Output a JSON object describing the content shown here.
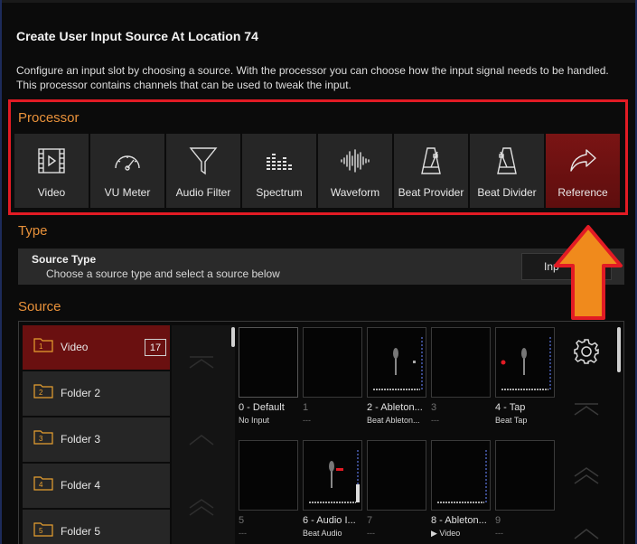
{
  "dialog": {
    "title": "Create User Input Source At Location 74",
    "description": "Configure an input slot by choosing a source. With the processor you can choose how the input signal needs to be handled. This processor contains channels that can be used to tweak the input."
  },
  "processor": {
    "label": "Processor",
    "buttons": [
      {
        "label": "Video",
        "icon": "video-icon"
      },
      {
        "label": "VU Meter",
        "icon": "gauge-icon"
      },
      {
        "label": "Audio Filter",
        "icon": "funnel-icon"
      },
      {
        "label": "Spectrum",
        "icon": "spectrum-icon"
      },
      {
        "label": "Waveform",
        "icon": "waveform-icon"
      },
      {
        "label": "Beat Provider",
        "icon": "metronome-icon"
      },
      {
        "label": "Beat Divider",
        "icon": "metronome-icon"
      },
      {
        "label": "Reference",
        "icon": "share-arrow-icon",
        "selected": true
      }
    ],
    "highlight_color": "#e21b24"
  },
  "type": {
    "label": "Type",
    "source_type_heading": "Source Type",
    "source_type_hint": "Choose a source type and select a source below",
    "button_label": "Inp"
  },
  "source": {
    "label": "Source",
    "folders": [
      {
        "num": "1",
        "name": "Video",
        "count": "17",
        "selected": true
      },
      {
        "num": "2",
        "name": "Folder 2"
      },
      {
        "num": "3",
        "name": "Folder 3"
      },
      {
        "num": "4",
        "name": "Folder 4"
      },
      {
        "num": "5",
        "name": "Folder 5"
      }
    ],
    "tiles": [
      {
        "title": "0 - Default",
        "subtitle": "No Input"
      },
      {
        "title": "1",
        "subtitle": "---"
      },
      {
        "title": "2 - Ableton...",
        "subtitle": "Beat  Ableton..."
      },
      {
        "title": "3",
        "subtitle": "---"
      },
      {
        "title": "4 - Tap",
        "subtitle": "Beat Tap"
      },
      {
        "title": "5",
        "subtitle": "---"
      },
      {
        "title": "6 - Audio I...",
        "subtitle": "Beat Audio"
      },
      {
        "title": "7",
        "subtitle": "---"
      },
      {
        "title": "8 - Ableton...",
        "subtitle": "▶ Video"
      },
      {
        "title": "9",
        "subtitle": "---"
      }
    ]
  },
  "colors": {
    "accent_orange": "#e8913a",
    "selected_red": "#6a1010",
    "arrow_orange": "#f08a1c"
  }
}
